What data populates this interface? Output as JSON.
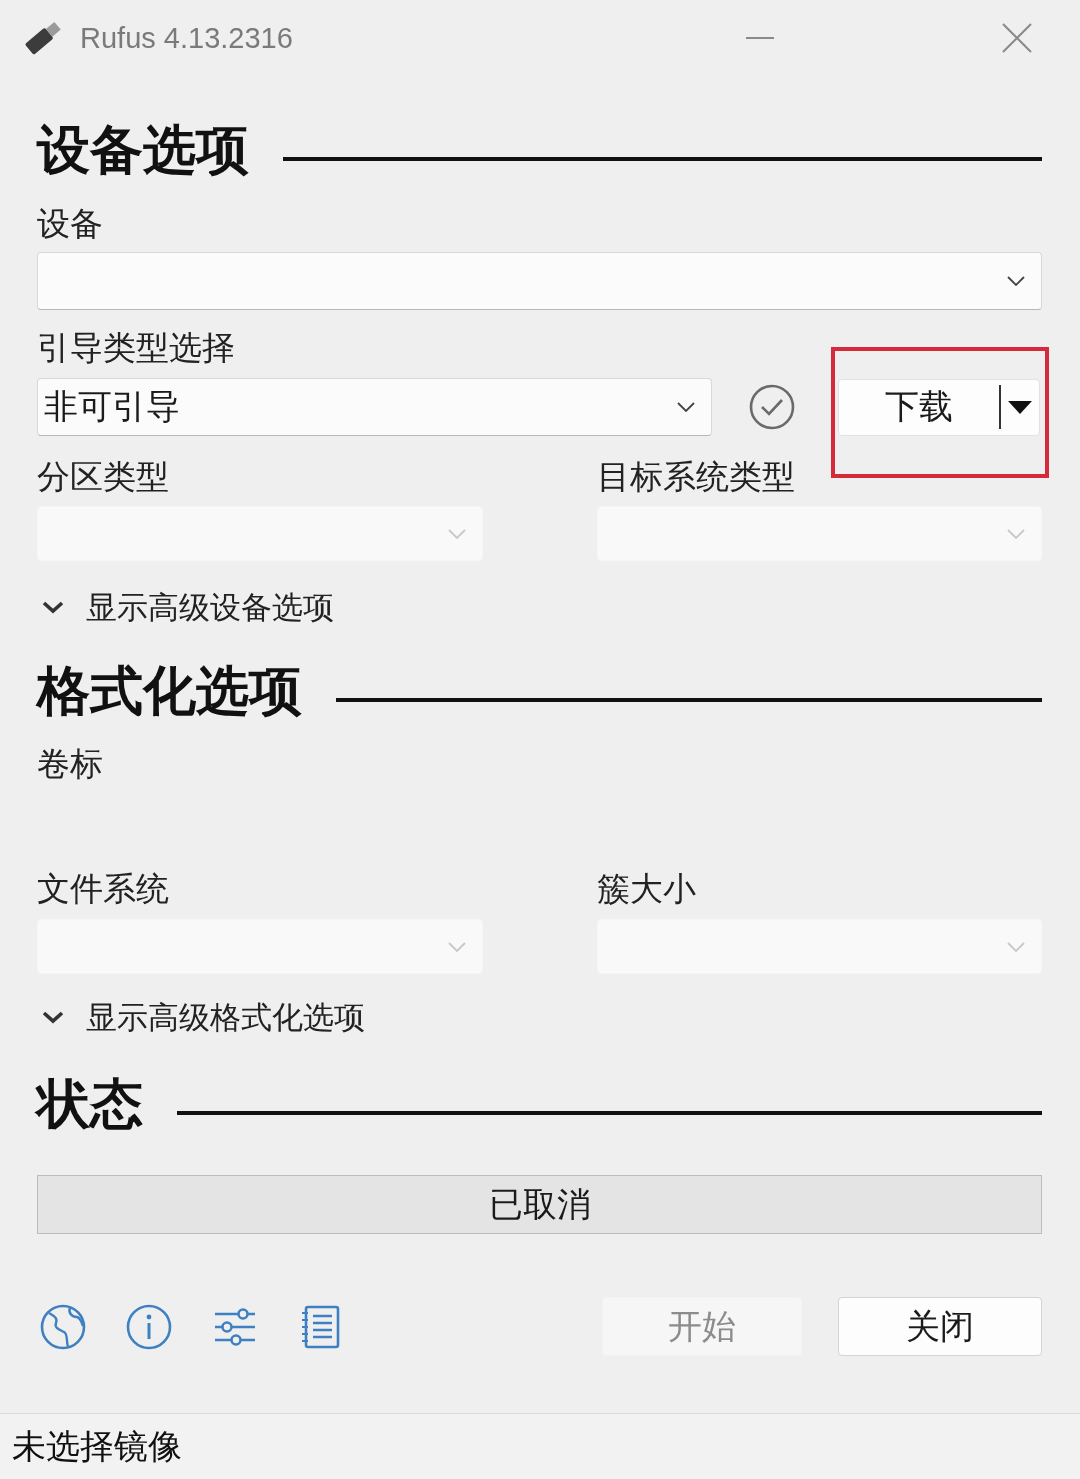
{
  "window": {
    "title": "Rufus 4.13.2316"
  },
  "device_options": {
    "title": "设备选项",
    "device": {
      "label": "设备"
    },
    "boot_selection": {
      "label": "引导类型选择",
      "value": "非可引导"
    },
    "download_button": {
      "label": "下载",
      "highlighted": true
    },
    "partition_scheme": {
      "label": "分区类型",
      "disabled": true
    },
    "target_system": {
      "label": "目标系统类型",
      "disabled": true
    },
    "advanced_toggle": {
      "label": "显示高级设备选项",
      "expanded": false
    }
  },
  "format_options": {
    "title": "格式化选项",
    "volume_label": {
      "label": "卷标"
    },
    "file_system": {
      "label": "文件系统",
      "disabled": true
    },
    "cluster_size": {
      "label": "簇大小",
      "disabled": true
    },
    "advanced_toggle": {
      "label": "显示高级格式化选项",
      "expanded": false
    }
  },
  "status": {
    "title": "状态",
    "text": "已取消"
  },
  "buttons": [
    {
      "label": "开始",
      "disabled": true
    },
    {
      "label": "关闭",
      "disabled": false
    }
  ],
  "status_bar": {
    "text": "未选择镜像"
  }
}
